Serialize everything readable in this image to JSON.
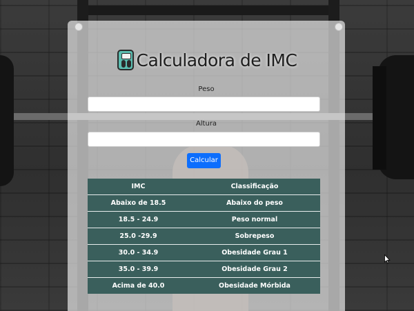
{
  "app": {
    "title": "Calculadora de IMC"
  },
  "form": {
    "peso_label": "Peso",
    "peso_value": "",
    "altura_label": "Altura",
    "altura_value": "",
    "calcular_button": "Calcular"
  },
  "table": {
    "headers": [
      "IMC",
      "Classificação"
    ],
    "rows": [
      [
        "Abaixo de 18.5",
        "Abaixo do peso"
      ],
      [
        "18.5 - 24.9",
        "Peso normal"
      ],
      [
        "25.0 -29.9",
        "Sobrepeso"
      ],
      [
        "30.0 - 34.9",
        "Obesidade Grau 1"
      ],
      [
        "35.0 - 39.9",
        "Obesidade Grau 2"
      ],
      [
        "Acima de 40.0",
        "Obesidade Mórbida"
      ]
    ]
  },
  "colors": {
    "table_bg": "#3a5f5c",
    "button_bg": "#0d6efd",
    "icon_accent": "#5bbdb0"
  },
  "icons": {
    "title_icon": "scale-icon",
    "pointer": "cursor-icon"
  }
}
